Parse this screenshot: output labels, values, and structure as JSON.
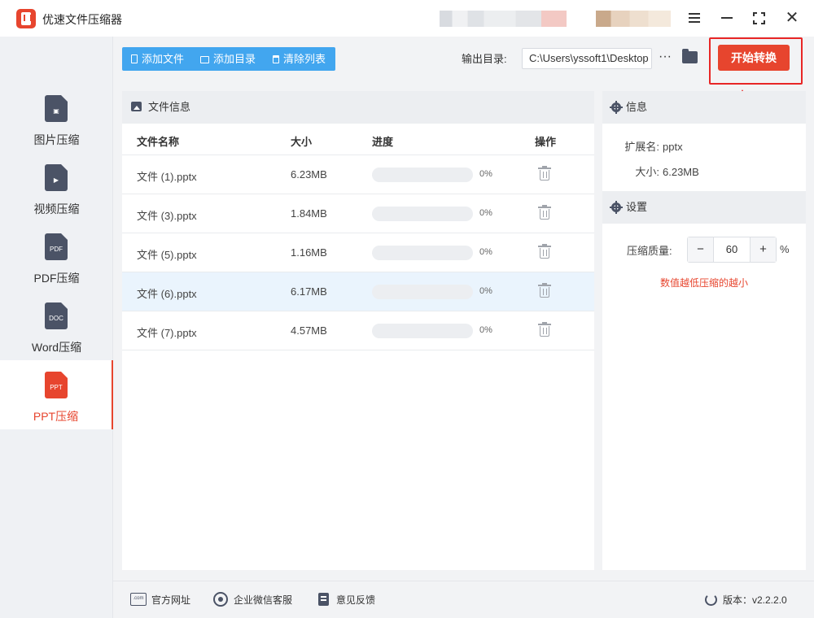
{
  "app": {
    "title": "优速文件压缩器"
  },
  "sidebar": {
    "items": [
      {
        "label": "图片压缩",
        "glyph": "▣",
        "icon": "image-file-icon",
        "active": false
      },
      {
        "label": "视频压缩",
        "glyph": "▶",
        "icon": "video-file-icon",
        "active": false
      },
      {
        "label": "PDF压缩",
        "glyph": "PDF",
        "icon": "pdf-file-icon",
        "active": false
      },
      {
        "label": "Word压缩",
        "glyph": "DOC",
        "icon": "doc-file-icon",
        "active": false
      },
      {
        "label": "PPT压缩",
        "glyph": "PPT",
        "icon": "ppt-file-icon",
        "active": true
      }
    ]
  },
  "toolbar": {
    "add_file": "添加文件",
    "add_dir": "添加目录",
    "clear_list": "清除列表",
    "output_label": "输出目录:",
    "output_path": "C:\\Users\\yssoft1\\Desktop",
    "more": "···",
    "start": "开始转换"
  },
  "file_panel": {
    "title": "文件信息",
    "columns": {
      "name": "文件名称",
      "size": "大小",
      "progress": "进度",
      "action": "操作"
    },
    "rows": [
      {
        "name": "文件 (1).pptx",
        "size": "6.23MB",
        "progress": 0,
        "progress_label": "0%",
        "selected": false
      },
      {
        "name": "文件 (3).pptx",
        "size": "1.84MB",
        "progress": 0,
        "progress_label": "0%",
        "selected": false
      },
      {
        "name": "文件 (5).pptx",
        "size": "1.16MB",
        "progress": 0,
        "progress_label": "0%",
        "selected": false
      },
      {
        "name": "文件 (6).pptx",
        "size": "6.17MB",
        "progress": 0,
        "progress_label": "0%",
        "selected": true
      },
      {
        "name": "文件 (7).pptx",
        "size": "4.57MB",
        "progress": 0,
        "progress_label": "0%",
        "selected": false
      }
    ]
  },
  "info": {
    "title": "信息",
    "ext_label": "扩展名:",
    "ext_value": "pptx",
    "size_label": "大小:",
    "size_value": "6.23MB"
  },
  "settings": {
    "title": "设置",
    "quality_label": "压缩质量:",
    "quality_value": "60",
    "minus": "−",
    "plus": "+",
    "unit": "%",
    "hint": "数值越低压缩的越小"
  },
  "footer": {
    "website": "官方网址",
    "wechat": "企业微信客服",
    "feedback": "意见反馈",
    "version": "版本：v2.2.2.0",
    "web_icon_text": ".com"
  },
  "colors": {
    "accent": "#e7452e",
    "toolbar_blue": "#42a6ef",
    "annotation_red": "#e82626"
  }
}
